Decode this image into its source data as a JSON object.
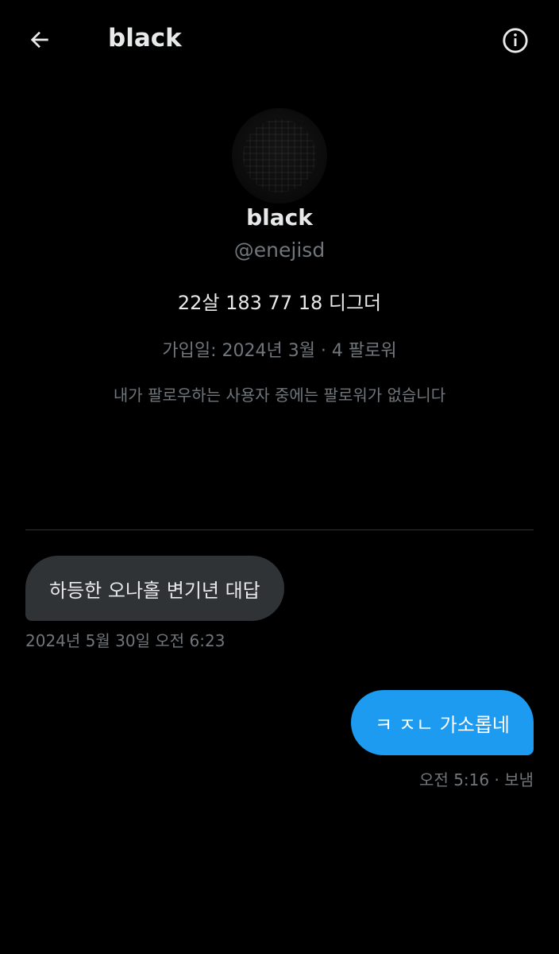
{
  "header": {
    "title": "black",
    "back_icon": "arrow-left-icon",
    "info_icon": "info-circle-icon"
  },
  "profile": {
    "display_name": "black",
    "handle": "@enejisd",
    "bio": "22살 183 77 18 디그더",
    "meta": "가입일: 2024년 3월 · 4 팔로워",
    "no_mutual_followers": "내가 팔로우하는 사용자 중에는 팔로워가 없습니다"
  },
  "messages": [
    {
      "direction": "received",
      "text": "하등한 오나홀 변기년 대답",
      "timestamp": "2024년 5월 30일 오전 6:23"
    },
    {
      "direction": "sent",
      "text": "ㅋ ㅈㄴ 가소롭네",
      "timestamp": "오전 5:16 · 보냄"
    }
  ],
  "colors": {
    "background": "#000000",
    "primary_text": "#e7e9ea",
    "secondary_text": "#71767b",
    "received_bubble": "#2f3336",
    "sent_bubble": "#1d9bf0",
    "divider": "#2f3336"
  }
}
